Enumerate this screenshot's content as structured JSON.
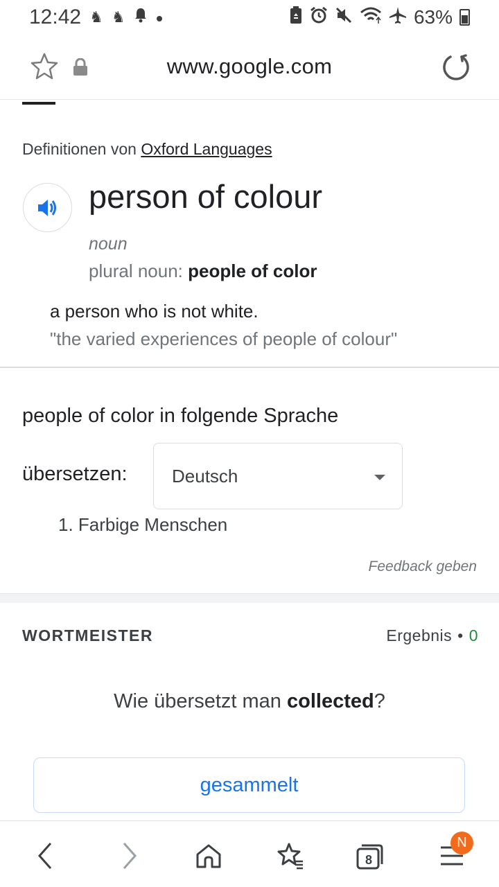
{
  "status_bar": {
    "time": "12:42",
    "battery": "63%",
    "left_icons": [
      "app-notification-icon",
      "app-notification-icon",
      "bell-icon",
      "dot-icon"
    ],
    "right_icons": [
      "battery-saver-icon",
      "alarm-icon",
      "mute-icon",
      "wifi-icon",
      "airplane-icon",
      "battery-icon"
    ]
  },
  "address_bar": {
    "url": "www.google.com"
  },
  "dictionary": {
    "source_prefix": "Definitionen von ",
    "source_link": "Oxford Languages",
    "headword": "person of colour",
    "part_of_speech": "noun",
    "plural_label": "plural noun",
    "plural_sep": ": ",
    "plural_value": "people of color",
    "definition": "a person who is not white.",
    "example": "\"the varied experiences of people of colour\""
  },
  "translate": {
    "heading": "people of color in folgende Sprache",
    "label": "übersetzen:",
    "selected_language": "Deutsch",
    "results": [
      "1. Farbige Menschen"
    ],
    "feedback": "Feedback geben"
  },
  "quiz": {
    "title": "WORTMEISTER",
    "score_label": "Ergebnis",
    "score_sep": "•",
    "score_value": "0",
    "question_prefix": "Wie übersetzt man ",
    "question_word": "collected",
    "question_suffix": "?",
    "answer": "gesammelt"
  },
  "bottom_nav": {
    "tabs_count": "8",
    "badge": "N"
  },
  "colors": {
    "link_blue": "#1a73e8",
    "audio_blue": "#1a73e8",
    "score_green": "#1e8e3e",
    "badge_orange": "#f26a1b"
  }
}
